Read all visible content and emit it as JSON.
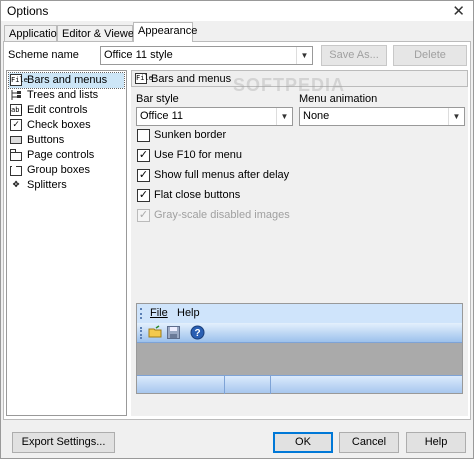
{
  "window": {
    "title": "Options"
  },
  "tabs": [
    {
      "label": "Application"
    },
    {
      "label": "Editor & Viewers"
    },
    {
      "label": "Appearance"
    }
  ],
  "scheme": {
    "label": "Scheme name",
    "value": "Office 11 style",
    "save_as_label": "Save As...",
    "delete_label": "Delete"
  },
  "nav": {
    "items": [
      {
        "label": "Bars and menus",
        "icon": "bars-icon",
        "glyph": "File"
      },
      {
        "label": "Trees and lists",
        "icon": "tree-icon",
        "glyph": ""
      },
      {
        "label": "Edit controls",
        "icon": "edit-control-icon",
        "glyph": "ab|"
      },
      {
        "label": "Check boxes",
        "icon": "checkbox-icon",
        "glyph": "✓"
      },
      {
        "label": "Buttons",
        "icon": "button-icon",
        "glyph": ""
      },
      {
        "label": "Page controls",
        "icon": "page-control-icon",
        "glyph": ""
      },
      {
        "label": "Group boxes",
        "icon": "group-box-icon",
        "glyph": ""
      },
      {
        "label": "Splitters",
        "icon": "splitter-icon",
        "glyph": "✥"
      }
    ]
  },
  "panel": {
    "header": "Bars and menus",
    "bar_style_label": "Bar style",
    "bar_style_value": "Office 11",
    "menu_animation_label": "Menu animation",
    "menu_animation_value": "None",
    "options": [
      {
        "label": "Sunken border",
        "checked": false,
        "disabled": false
      },
      {
        "label": "Use F10 for menu",
        "checked": true,
        "disabled": false
      },
      {
        "label": "Show full menus after delay",
        "checked": true,
        "disabled": false
      },
      {
        "label": "Flat close buttons",
        "checked": true,
        "disabled": false
      },
      {
        "label": "Gray-scale disabled images",
        "checked": true,
        "disabled": true
      }
    ]
  },
  "preview": {
    "menu_file": "File",
    "menu_help": "Help"
  },
  "watermark": "SOFTPEDIA",
  "footer": {
    "export_label": "Export Settings...",
    "ok_label": "OK",
    "cancel_label": "Cancel",
    "help_label": "Help"
  },
  "colors": {
    "accent": "#0078d7",
    "office_bar_light": "#cfe4fb",
    "office_bar_dark": "#9cc1ec"
  }
}
